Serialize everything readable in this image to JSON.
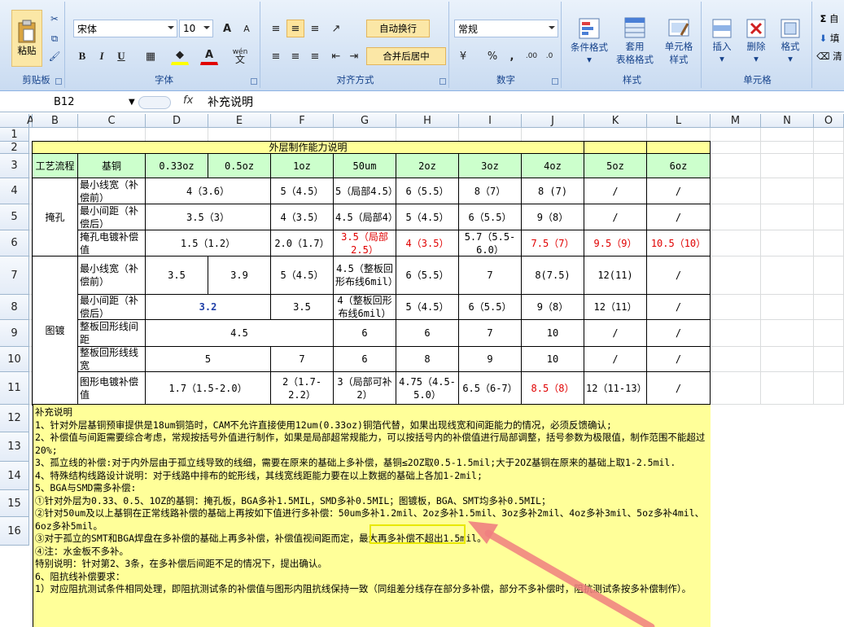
{
  "ribbon": {
    "clipboard": {
      "paste": "粘贴",
      "label": "剪贴板"
    },
    "font": {
      "name": "宋体",
      "size": "10",
      "bold": "B",
      "italic": "I",
      "underline": "U",
      "label": "字体",
      "grow": "A",
      "shrink": "A",
      "wen": "wén"
    },
    "align": {
      "wrap": "自动换行",
      "merge": "合并后居中",
      "label": "对齐方式"
    },
    "number": {
      "format": "常规",
      "percent": "%",
      "comma": ",",
      "label": "数字"
    },
    "styles": {
      "cond": "条件格式",
      "table": "套用",
      "table2": "表格格式",
      "cell": "单元格",
      "cell2": "样式",
      "label": "样式"
    },
    "cells": {
      "insert": "插入",
      "delete": "删除",
      "format": "格式",
      "label": "单元格"
    },
    "edit": {
      "sigma": "Σ",
      "a": "自",
      "b": "填",
      "c": "清"
    }
  },
  "formula_bar": {
    "name_box": "B12",
    "fx": "fx",
    "content": "补充说明"
  },
  "columns": [
    "A",
    "B",
    "C",
    "D",
    "E",
    "F",
    "G",
    "H",
    "I",
    "J",
    "K",
    "L",
    "M",
    "N",
    "O"
  ],
  "rows": [
    "1",
    "2",
    "3",
    "4",
    "5",
    "6",
    "7",
    "8",
    "9",
    "10",
    "11",
    "12",
    "13",
    "14",
    "15",
    "16"
  ],
  "table": {
    "title": "外层制作能力说明",
    "headers": [
      "工艺流程",
      "基铜",
      "0.33oz",
      "0.5oz",
      "1oz",
      "50um",
      "2oz",
      "3oz",
      "4oz",
      "5oz",
      "6oz"
    ],
    "group_masking": "掩孔",
    "group_plating": "图镀",
    "r4": [
      "最小线宽（补偿前）",
      "4（3.6）",
      "5（4.5）",
      "5（局部4.5）",
      "6（5.5）",
      "8（7）",
      "8 (7)",
      "/",
      "/"
    ],
    "r5": [
      "最小间距（补偿后）",
      "3.5（3）",
      "4（3.5）",
      "4.5（局部4）",
      "5（4.5）",
      "6（5.5）",
      "9（8）",
      "/",
      "/"
    ],
    "r6": [
      "掩孔电镀补偿值",
      "1.5（1.2）",
      "2.0（1.7）",
      "3.5（局部2.5）",
      "4（3.5）",
      "5.7（5.5-6.0）",
      "7.5（7）",
      "9.5（9）",
      "10.5（10）"
    ],
    "r7": [
      "最小线宽（补偿前）",
      "3.5",
      "3.9",
      "5（4.5）",
      "4.5（整板回形布线6mil）",
      "6（5.5）",
      "7",
      "8(7.5)",
      "12(11)",
      "/"
    ],
    "r8": [
      "最小间距（补偿后）",
      "3.2",
      "3.5",
      "4（整板回形布线6mil）",
      "5（4.5）",
      "6（5.5）",
      "9（8）",
      "12（11）",
      "/"
    ],
    "r9": [
      "整板回形线间距",
      "4.5",
      "6",
      "6",
      "7",
      "10",
      "/",
      "/"
    ],
    "r10": [
      "整板回形线线宽",
      "5",
      "7",
      "6",
      "8",
      "9",
      "10",
      "/",
      "/"
    ],
    "r11": [
      "图形电镀补偿值",
      "1.7（1.5-2.0）",
      "2（1.7-2.2）",
      "3（局部可补2）",
      "4.75（4.5-5.0）",
      "6.5（6-7）",
      "8.5（8）",
      "12（11-13）",
      "/"
    ]
  },
  "notes": [
    "补充说明",
    "1、针对外层基铜预审提供是18um铜箔时，CAM不允许直接使用12um(0.33oz)铜箔代替，如果出现线宽和间距能力的情况，必须反馈确认;",
    "2、补偿值与间距需要综合考虑，常规按括号外值进行制作，如果是局部超常规能力，可以按括号内的补偿值进行局部调整，括号参数为极限值，制作范围不能超过20%;",
    "3、孤立线的补偿:对于内外层由于孤立线导致的线细，需要在原来的基础上多补偿，基铜≤2OZ取0.5-1.5mil;大于2OZ基铜在原来的基础上取1-2.5mil.",
    "4、特殊结构线路设计说明：对于线路中排布的蛇形线，其线宽线距能力要在以上数据的基础上各加1-2mil;",
    "5、BGA与SMD需多补偿:",
    "①针对外层为0.33、0.5、1OZ的基铜：掩孔板，BGA多补1.5MIL，SMD多补0.5MIL；图镀板，BGA、SMT均多补0.5MIL；",
    "②针对50um及以上基铜在正常线路补偿的基础上再按如下值进行多补偿：50um多补1.2mil、2oz多补1.5mil、3oz多补2mil、4oz多补3mil、5oz多补4mil、6oz多补5mil。",
    "③对于孤立的SMT和BGA焊盘在多补偿的基础上再多补偿，补偿值视间距而定，最大再多补偿不超出1.5mil。",
    "④注：水金板不多补。",
    "特别说明：针对第2、3条，在多补偿后间距不足的情况下，提出确认。",
    "6、阻抗线补偿要求：",
    "1）对应阻抗测试条件相同处理，即阻抗测试条的补偿值与图形内阻抗线保持一致（同组差分线存在部分多补偿，部分不多补偿时，阻抗测试条按多补偿制作）。"
  ],
  "colors": {
    "title_fill": "#ffff99",
    "header_fill": "#ccffcc",
    "red_text": "#e00000",
    "highlight_box": "#e8e800",
    "arrow": "#f08080"
  }
}
